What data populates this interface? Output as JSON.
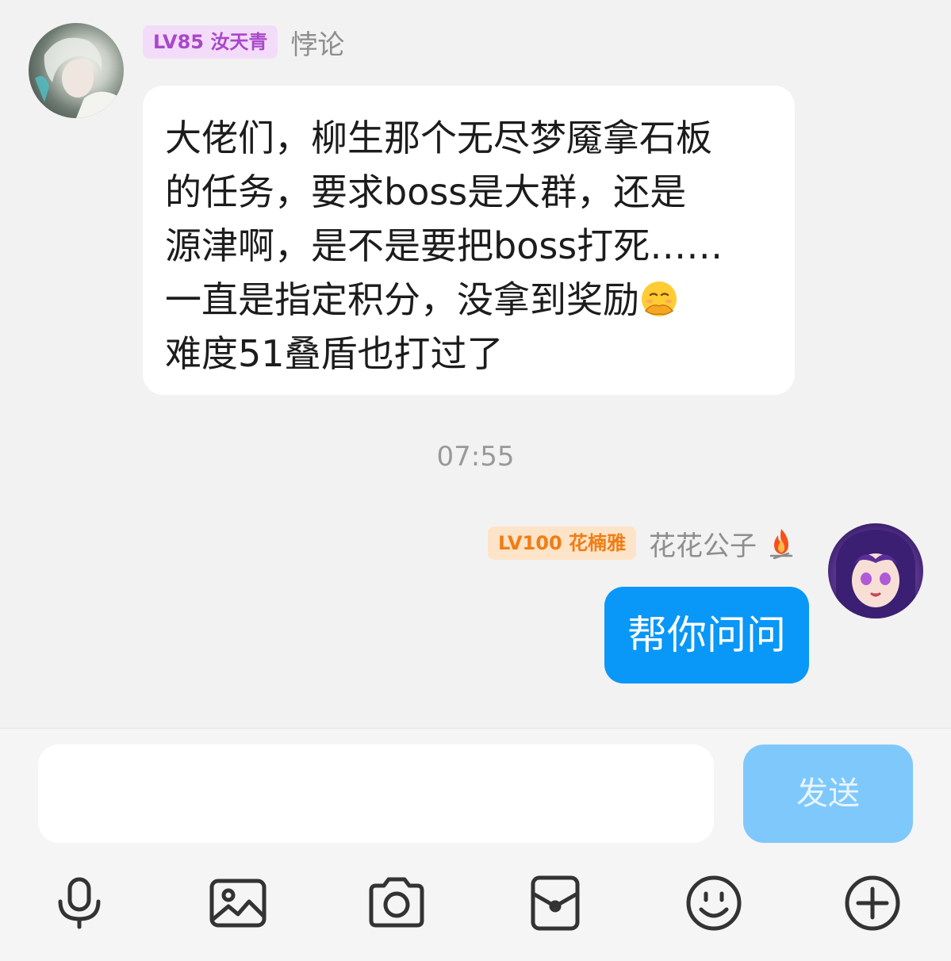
{
  "messages": {
    "incoming": {
      "level_badge": "LV85 汝天青",
      "nickname": "悖论",
      "lines": [
        "大佬们，柳生那个无尽梦魇拿石板",
        "的任务，要求boss是大群，还是",
        "源津啊，是不是要把boss打死……",
        "一直是指定积分，没拿到奖励",
        "难度51叠盾也打过了"
      ],
      "emoji": "face-with-hand-over-mouth"
    },
    "timestamp": "07:55",
    "outgoing": {
      "level_badge": "LV100 花楠雅",
      "nickname": "花花公子",
      "text": "帮你问问"
    }
  },
  "composer": {
    "input_value": "",
    "send_label": "发送"
  },
  "toolbar": {
    "icons": [
      "microphone-icon",
      "image-icon",
      "camera-icon",
      "red-packet-icon",
      "emoji-icon",
      "plus-icon"
    ]
  },
  "colors": {
    "background": "#f2f2f2",
    "outgoing_bubble": "#0997f8",
    "send_button": "#7fc8fb",
    "purple_badge": "#a947c9",
    "orange_badge": "#f07d14"
  }
}
